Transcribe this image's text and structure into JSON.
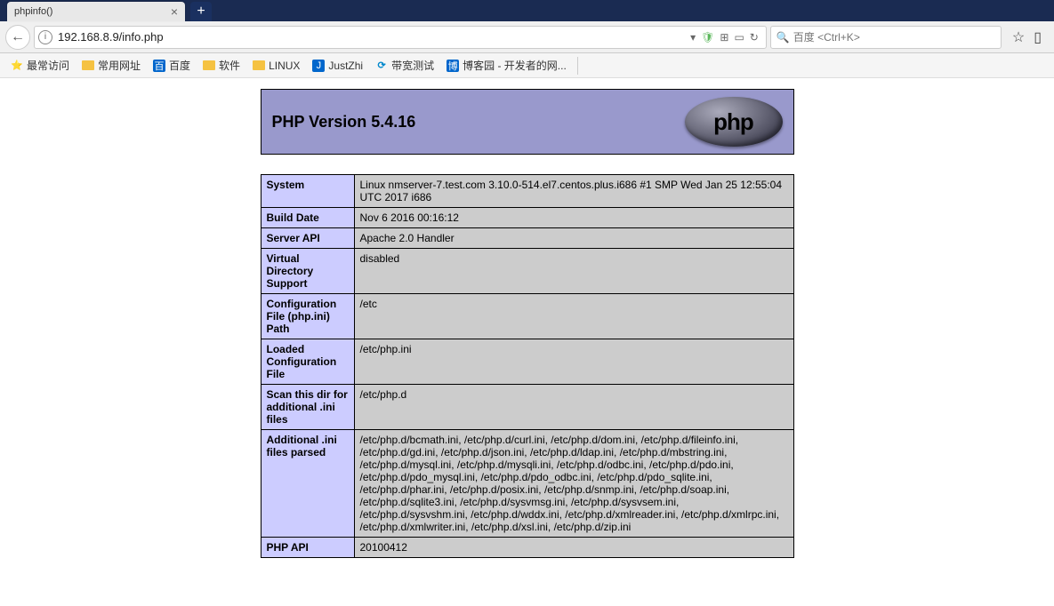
{
  "tab": {
    "title": "phpinfo()"
  },
  "url": "192.168.8.9/info.php",
  "search": {
    "placeholder": "百度 <Ctrl+K>"
  },
  "bookmarks": [
    {
      "label": "最常访问",
      "icon": "folder"
    },
    {
      "label": "常用网址",
      "icon": "folder"
    },
    {
      "label": "百度",
      "icon": "baidu"
    },
    {
      "label": "软件",
      "icon": "folder"
    },
    {
      "label": "LINUX",
      "icon": "folder"
    },
    {
      "label": "JustZhi",
      "icon": "blue-j"
    },
    {
      "label": "带宽测试",
      "icon": "speed"
    },
    {
      "label": "博客园 - 开发者的网...",
      "icon": "blue-c"
    }
  ],
  "php": {
    "title": "PHP Version 5.4.16",
    "rows": [
      {
        "key": "System",
        "val": "Linux nmserver-7.test.com 3.10.0-514.el7.centos.plus.i686 #1 SMP Wed Jan 25 12:55:04 UTC 2017 i686"
      },
      {
        "key": "Build Date",
        "val": "Nov 6 2016 00:16:12"
      },
      {
        "key": "Server API",
        "val": "Apache 2.0 Handler"
      },
      {
        "key": "Virtual Directory Support",
        "val": "disabled"
      },
      {
        "key": "Configuration File (php.ini) Path",
        "val": "/etc"
      },
      {
        "key": "Loaded Configuration File",
        "val": "/etc/php.ini"
      },
      {
        "key": "Scan this dir for additional .ini files",
        "val": "/etc/php.d"
      },
      {
        "key": "Additional .ini files parsed",
        "val": "/etc/php.d/bcmath.ini, /etc/php.d/curl.ini, /etc/php.d/dom.ini, /etc/php.d/fileinfo.ini, /etc/php.d/gd.ini, /etc/php.d/json.ini, /etc/php.d/ldap.ini, /etc/php.d/mbstring.ini, /etc/php.d/mysql.ini, /etc/php.d/mysqli.ini, /etc/php.d/odbc.ini, /etc/php.d/pdo.ini, /etc/php.d/pdo_mysql.ini, /etc/php.d/pdo_odbc.ini, /etc/php.d/pdo_sqlite.ini, /etc/php.d/phar.ini, /etc/php.d/posix.ini, /etc/php.d/snmp.ini, /etc/php.d/soap.ini, /etc/php.d/sqlite3.ini, /etc/php.d/sysvmsg.ini, /etc/php.d/sysvsem.ini, /etc/php.d/sysvshm.ini, /etc/php.d/wddx.ini, /etc/php.d/xmlreader.ini, /etc/php.d/xmlrpc.ini, /etc/php.d/xmlwriter.ini, /etc/php.d/xsl.ini, /etc/php.d/zip.ini"
      },
      {
        "key": "PHP API",
        "val": "20100412"
      }
    ]
  }
}
